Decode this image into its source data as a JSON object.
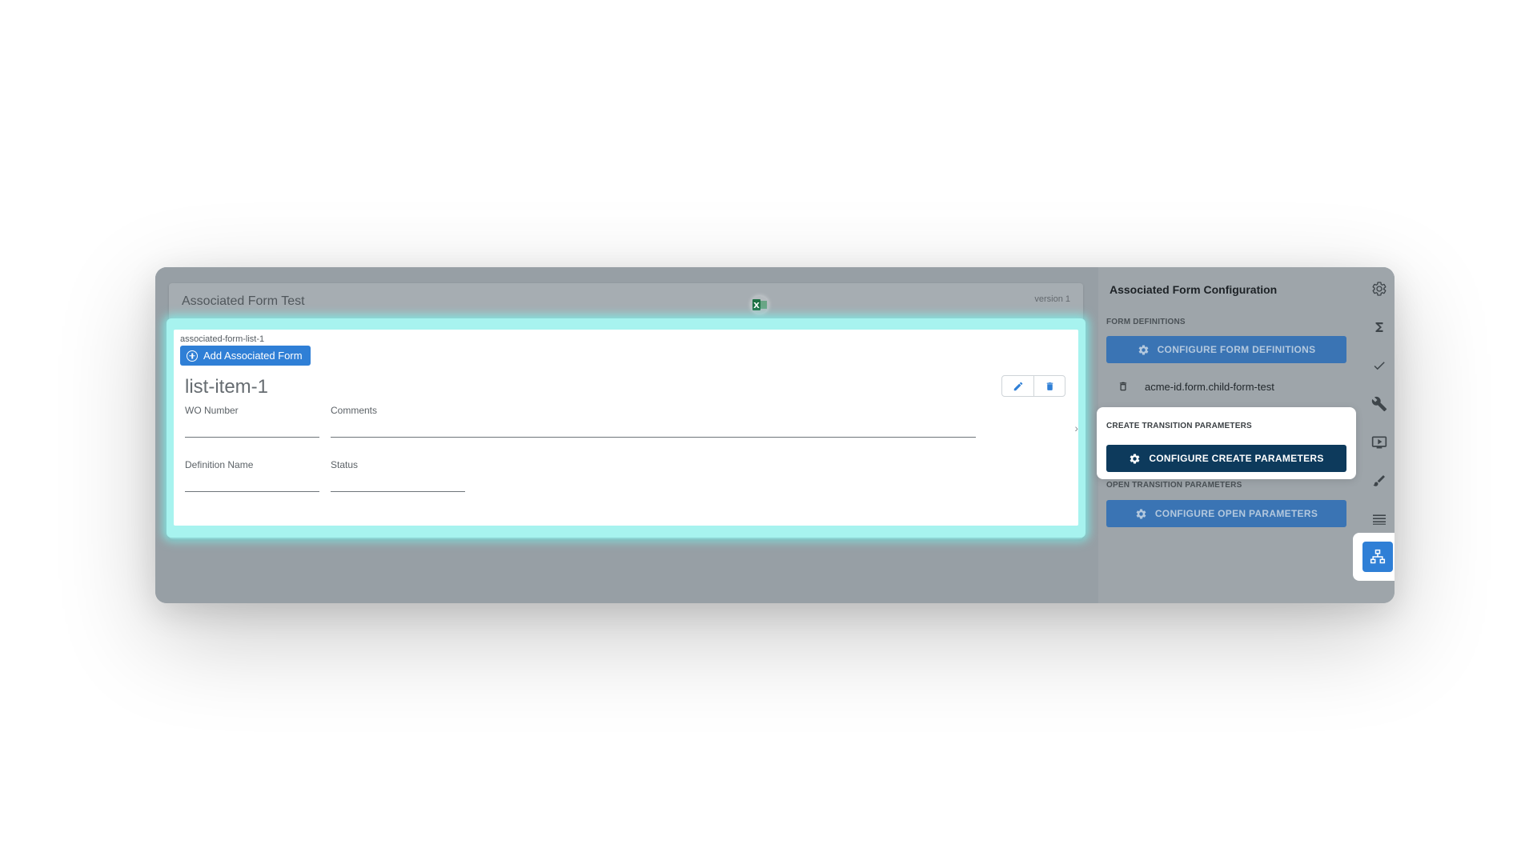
{
  "form": {
    "title": "Associated Form Test",
    "version": "version 1",
    "list": {
      "id": "associated-form-list-1",
      "add_button_label": "Add Associated Form",
      "item_title": "list-item-1",
      "fields": {
        "wo_number": "WO Number",
        "comments": "Comments",
        "definition_name": "Definition Name",
        "status": "Status"
      }
    }
  },
  "sidebar": {
    "title": "Associated Form Configuration",
    "form_definitions": {
      "label": "FORM DEFINITIONS",
      "button_label": "CONFIGURE FORM DEFINITIONS",
      "definition_name": "acme-id.form.child-form-test"
    },
    "create_transition": {
      "label": "CREATE TRANSITION PARAMETERS",
      "button_label": "CONFIGURE CREATE PARAMETERS"
    },
    "open_transition": {
      "label": "OPEN TRANSITION PARAMETERS",
      "button_label": "CONFIGURE OPEN PARAMETERS"
    }
  },
  "rail_icons": [
    "gear-icon",
    "sigma-icon",
    "check-icon",
    "wrench-icon",
    "tv-play-icon",
    "brush-icon",
    "lines-icon",
    "hierarchy-icon"
  ],
  "colors": {
    "accent": "#2f7fd6",
    "active_button": "#0d3a5c",
    "highlight": "#7df0eb"
  }
}
